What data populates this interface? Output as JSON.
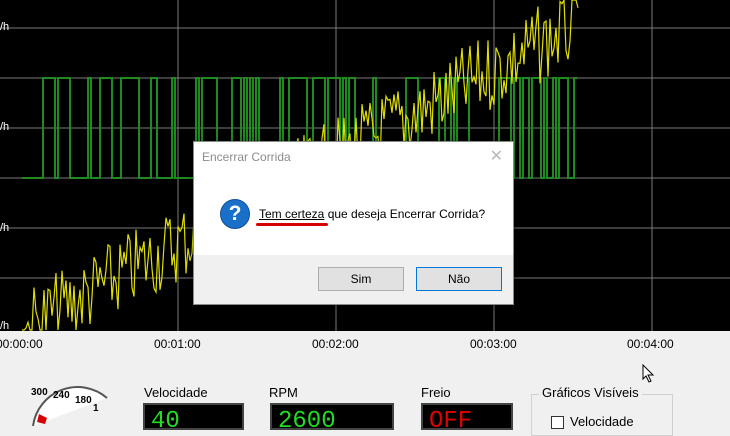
{
  "chart": {
    "y_labels": [
      "/h",
      "/h",
      "/h",
      "/h"
    ],
    "x_ticks": [
      "00:00:00",
      "00:01:00",
      "00:02:00",
      "00:03:00",
      "00:04:00"
    ],
    "colors": {
      "background": "#000000",
      "grid": "#7a7a7a",
      "green_series": "#1f8a1f",
      "yellow_series": "#e0e000"
    }
  },
  "dialog": {
    "title": "Encerrar Corrida",
    "close_label": "✕",
    "icon": "question-icon",
    "icon_glyph": "?",
    "message_part1": "Tem certeza",
    "message_part2": " que deseja Encerrar Corrida?",
    "buttons": {
      "yes": "Sim",
      "no": "Não"
    }
  },
  "dashboard": {
    "gauge": {
      "scale": [
        "300",
        "240",
        "180",
        "1"
      ],
      "icon": "speedometer-icon"
    },
    "velocidade": {
      "label": "Velocidade",
      "value": "40"
    },
    "rpm": {
      "label": "RPM",
      "value": "2600"
    },
    "freio": {
      "label": "Freio",
      "value": "OFF"
    },
    "graficos": {
      "title": "Gráficos Visíveis",
      "checkbox_label": "Velocidade",
      "checked": false
    }
  }
}
